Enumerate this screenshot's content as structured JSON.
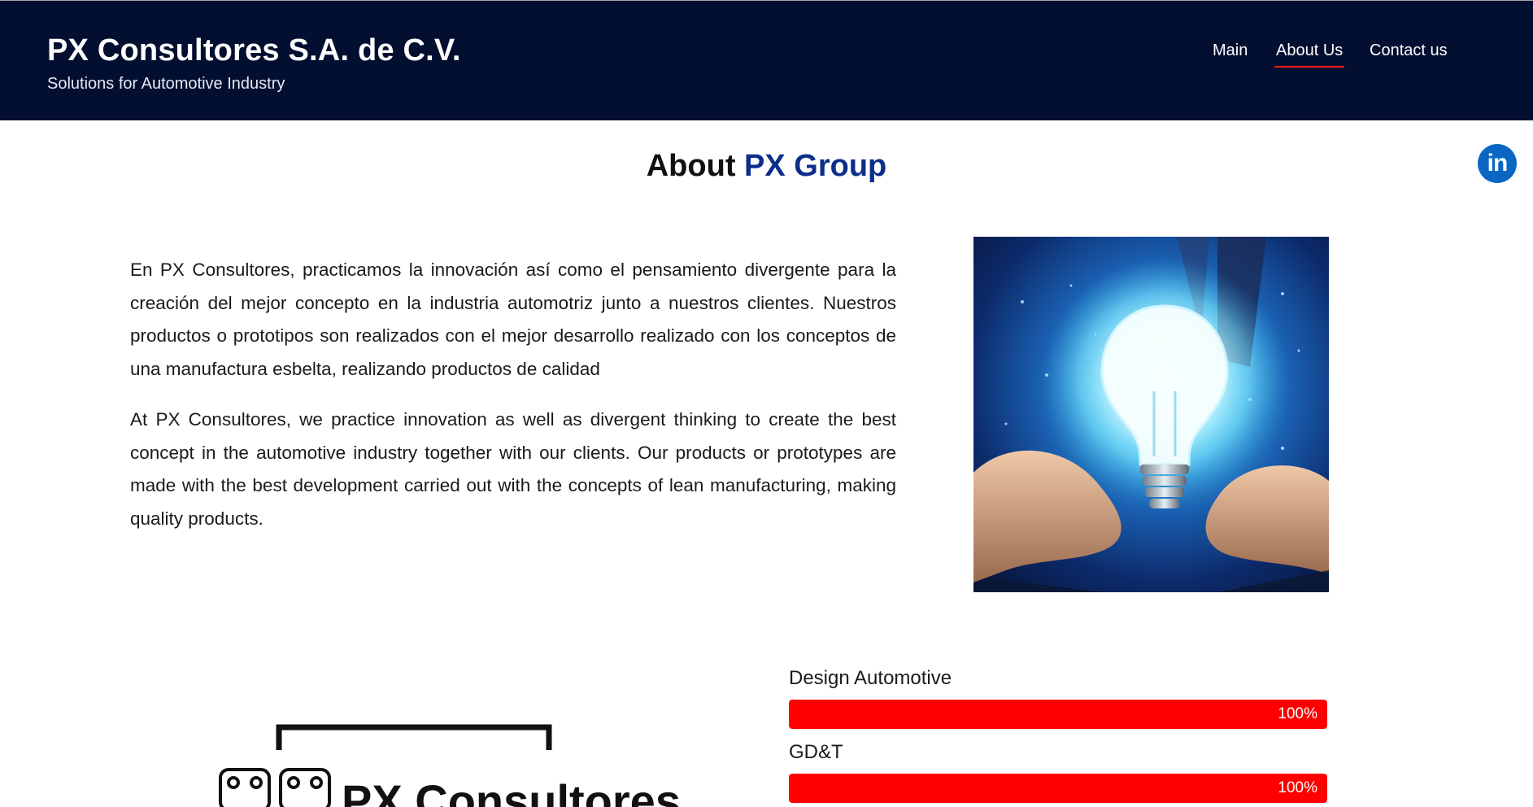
{
  "header": {
    "title": "PX Consultores S.A. de C.V.",
    "tagline": "Solutions for Automotive Industry",
    "background_color": "#030f30"
  },
  "nav": {
    "items": [
      {
        "label": "Main",
        "active": false
      },
      {
        "label": "About Us",
        "active": true
      },
      {
        "label": "Contact us",
        "active": false
      }
    ],
    "active_underline_color": "#ff1a1a"
  },
  "social": {
    "icon": "linkedin-icon",
    "label": "in",
    "color": "#0a66c2"
  },
  "about": {
    "title_prefix": "About",
    "title_accent": "PX Group",
    "accent_color": "#0d2d8a",
    "paragraph_es": "En PX Consultores, practicamos la innovación así como el pensamiento divergente para la creación del mejor concepto en la industria automotriz junto a nuestros clientes. Nuestros productos o prototipos son realizados con el mejor desarrollo realizado con los conceptos de una manufactura esbelta, realizando productos de calidad",
    "paragraph_en": "At PX Consultores, we practice innovation as well as divergent thinking to create the best concept in the automotive industry together with our clients. Our products or prototypes are made with the best development carried out with the concepts of lean manufacturing, making quality products."
  },
  "logo": {
    "text": "PX Consultores"
  },
  "skills": [
    {
      "label": "Design Automotive",
      "value_text": "100%",
      "fraction": 1.0
    },
    {
      "label": "GD&T",
      "value_text": "100%",
      "fraction": 1.0
    }
  ],
  "skill_bar_color": "#ff0000"
}
